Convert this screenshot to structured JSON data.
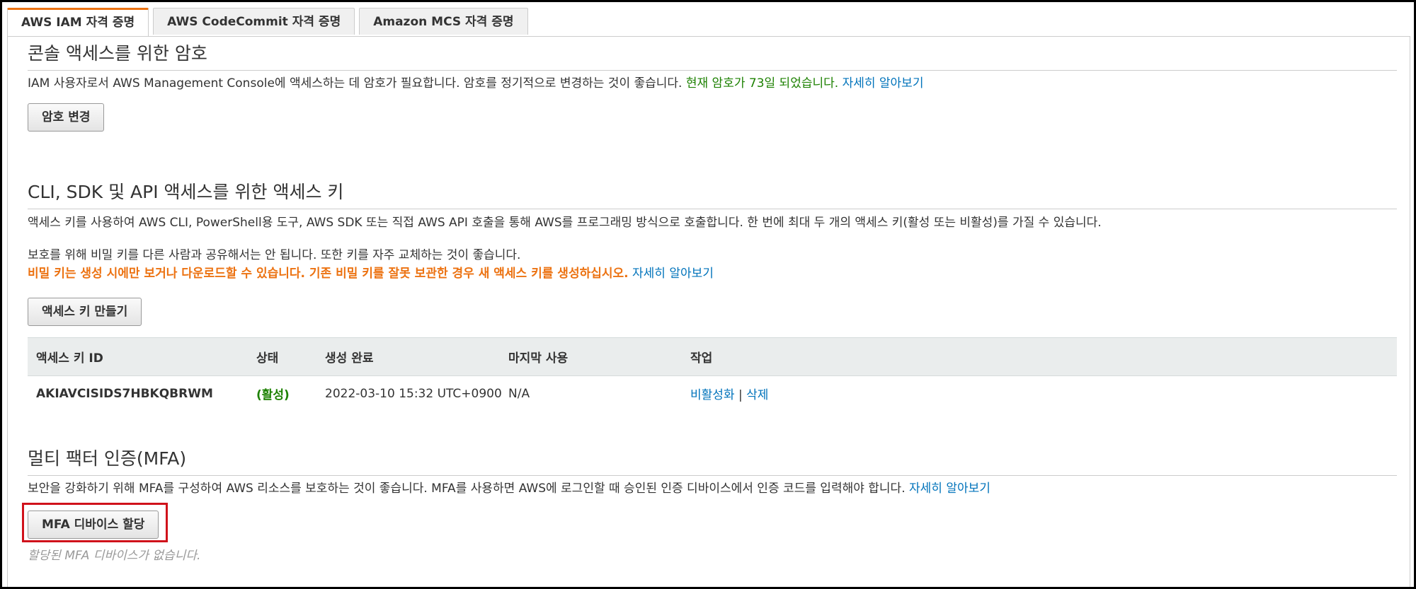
{
  "tabs": [
    {
      "label": "AWS IAM 자격 증명",
      "active": true
    },
    {
      "label": "AWS CodeCommit 자격 증명",
      "active": false
    },
    {
      "label": "Amazon MCS 자격 증명",
      "active": false
    }
  ],
  "console_password": {
    "title": "콘솔 액세스를 위한 암호",
    "description": "IAM 사용자로서 AWS Management Console에 액세스하는 데 암호가 필요합니다. 암호를 정기적으로 변경하는 것이 좋습니다. ",
    "password_age": "현재 암호가 73일 되었습니다.",
    "learn_more": "자세히 알아보기",
    "change_button": "암호 변경"
  },
  "access_keys": {
    "title": "CLI, SDK 및 API 액세스를 위한 액세스 키",
    "description": "액세스 키를 사용하여 AWS CLI, PowerShell용 도구, AWS SDK 또는 직접 AWS API 호출을 통해 AWS를 프로그래밍 방식으로 호출합니다. 한 번에 최대 두 개의 액세스 키(활성 또는 비활성)를 가질 수 있습니다.",
    "security_note": "보호를 위해 비밀 키를 다른 사람과 공유해서는 안 됩니다. 또한 키를 자주 교체하는 것이 좋습니다.",
    "warning": "비밀 키는 생성 시에만 보거나 다운로드할 수 있습니다. 기존 비밀 키를 잘못 보관한 경우 새 액세스 키를 생성하십시오.",
    "learn_more": "자세히 알아보기",
    "create_button": "액세스 키 만들기",
    "table": {
      "headers": [
        "액세스 키 ID",
        "상태",
        "생성 완료",
        "마지막 사용",
        "작업"
      ],
      "rows": [
        {
          "key_id": "AKIAVCISIDS7HBKQBRWM",
          "status": "(활성)",
          "created": "2022-03-10 15:32 UTC+0900",
          "last_used": "N/A",
          "action_deactivate": "비활성화",
          "action_separator": " | ",
          "action_delete": "삭제"
        }
      ]
    }
  },
  "mfa": {
    "title": "멀티 팩터 인증(MFA)",
    "description": "보안을 강화하기 위해 MFA를 구성하여 AWS 리소스를 보호하는 것이 좋습니다. MFA를 사용하면 AWS에 로그인할 때 승인된 인증 디바이스에서 인증 코드를 입력해야 합니다. ",
    "learn_more": "자세히 알아보기",
    "assign_button": "MFA 디바이스 할당",
    "empty_message": "할당된 MFA 디바이스가 없습니다."
  },
  "colors": {
    "tab_accent": "#ec7211",
    "link": "#0073bb",
    "success": "#1d8102",
    "warning": "#ec7211",
    "highlight_box": "#d0121b"
  }
}
